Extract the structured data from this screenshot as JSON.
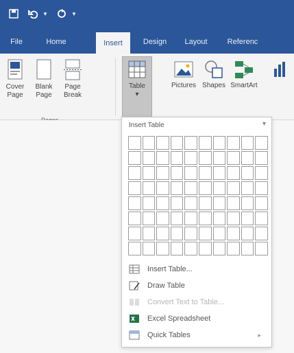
{
  "qat": {
    "save_icon": "save-icon",
    "undo_icon": "undo-icon",
    "redo_icon": "redo-icon"
  },
  "tabs": [
    {
      "label": "File"
    },
    {
      "label": "Home"
    },
    {
      "label": "Insert"
    },
    {
      "label": "Design"
    },
    {
      "label": "Layout"
    },
    {
      "label": "Referenc"
    }
  ],
  "ribbon": {
    "cover_page": "Cover Page",
    "blank_page": "Blank Page",
    "page_break": "Page Break",
    "pages_group": "Pages",
    "table": "Table",
    "pictures": "Pictures",
    "shapes": "Shapes",
    "smartart": "SmartArt"
  },
  "table_menu": {
    "title": "Insert Table",
    "items": [
      {
        "label": "Insert Table..."
      },
      {
        "label": "Draw Table"
      },
      {
        "label": "Convert Text to Table..."
      },
      {
        "label": "Excel Spreadsheet"
      },
      {
        "label": "Quick Tables"
      }
    ]
  },
  "colors": {
    "accent": "#2b579a",
    "excel": "#217346"
  }
}
